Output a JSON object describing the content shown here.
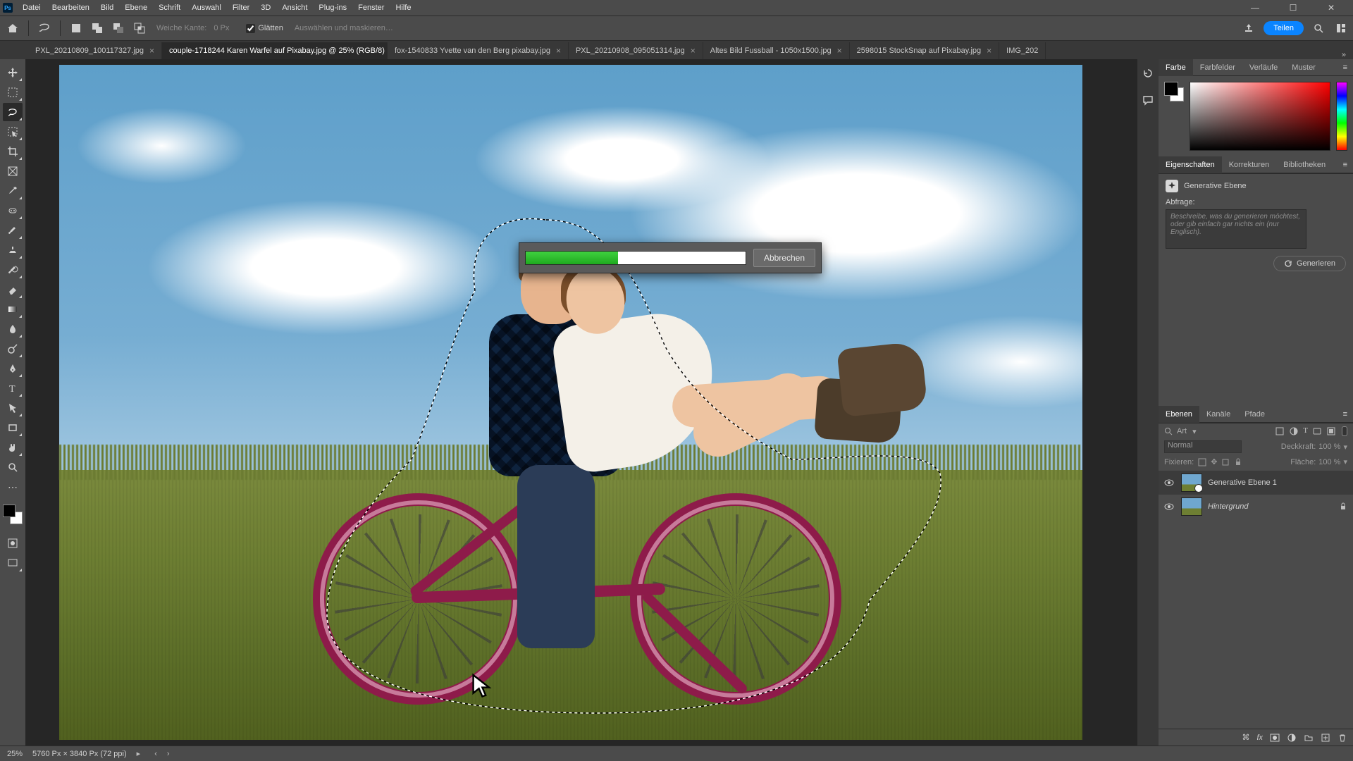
{
  "menu": {
    "items": [
      "Datei",
      "Bearbeiten",
      "Bild",
      "Ebene",
      "Schrift",
      "Auswahl",
      "Filter",
      "3D",
      "Ansicht",
      "Plug-ins",
      "Fenster",
      "Hilfe"
    ]
  },
  "options": {
    "feather_label": "Weiche Kante:",
    "feather_value": "0 Px",
    "antialias_label": "Glätten",
    "antialias_checked": true,
    "refine_label": "Auswählen und maskieren…",
    "share_label": "Teilen"
  },
  "tabs": [
    {
      "label": "PXL_20210809_100117327.jpg",
      "active": false
    },
    {
      "label": "couple-1718244 Karen Warfel auf Pixabay.jpg @ 25% (RGB/8)",
      "active": true
    },
    {
      "label": "fox-1540833 Yvette van den Berg pixabay.jpg",
      "active": false
    },
    {
      "label": "PXL_20210908_095051314.jpg",
      "active": false
    },
    {
      "label": "Altes Bild Fussball - 1050x1500.jpg",
      "active": false
    },
    {
      "label": "2598015 StockSnap auf Pixabay.jpg",
      "active": false
    },
    {
      "label": "IMG_202",
      "active": false
    }
  ],
  "dialog": {
    "progress_pct": 42,
    "cancel_label": "Abbrechen"
  },
  "color_tabs": [
    "Farbe",
    "Farbfelder",
    "Verläufe",
    "Muster"
  ],
  "properties": {
    "tabs": [
      "Eigenschaften",
      "Korrekturen",
      "Bibliotheken"
    ],
    "type_label": "Generative Ebene",
    "prompt_label": "Abfrage:",
    "prompt_placeholder": "Beschreibe, was du generieren möchtest, oder gib einfach gar nichts ein (nur Englisch).",
    "generate_label": "Generieren"
  },
  "layers": {
    "tabs": [
      "Ebenen",
      "Kanäle",
      "Pfade"
    ],
    "search_placeholder": "Art",
    "blend_mode": "Normal",
    "opacity_label": "Deckkraft:",
    "opacity_value": "100 %",
    "lock_label": "Fixieren:",
    "fill_label": "Fläche:",
    "fill_value": "100 %",
    "items": [
      {
        "name": "Generative Ebene 1",
        "italic": false,
        "locked": false,
        "generative": true
      },
      {
        "name": "Hintergrund",
        "italic": true,
        "locked": true,
        "generative": false
      }
    ]
  },
  "status": {
    "zoom": "25%",
    "doc_info": "5760 Px × 3840 Px (72 ppi)"
  },
  "tool_names": [
    "move",
    "rect-marquee",
    "lasso",
    "magic-wand",
    "crop",
    "frame",
    "eyedropper",
    "spot-heal",
    "brush",
    "clone",
    "history-brush",
    "eraser",
    "gradient",
    "blur",
    "dodge",
    "pen",
    "type",
    "path-select",
    "rectangle",
    "hand",
    "zoom"
  ],
  "selected_tool_index": 2
}
